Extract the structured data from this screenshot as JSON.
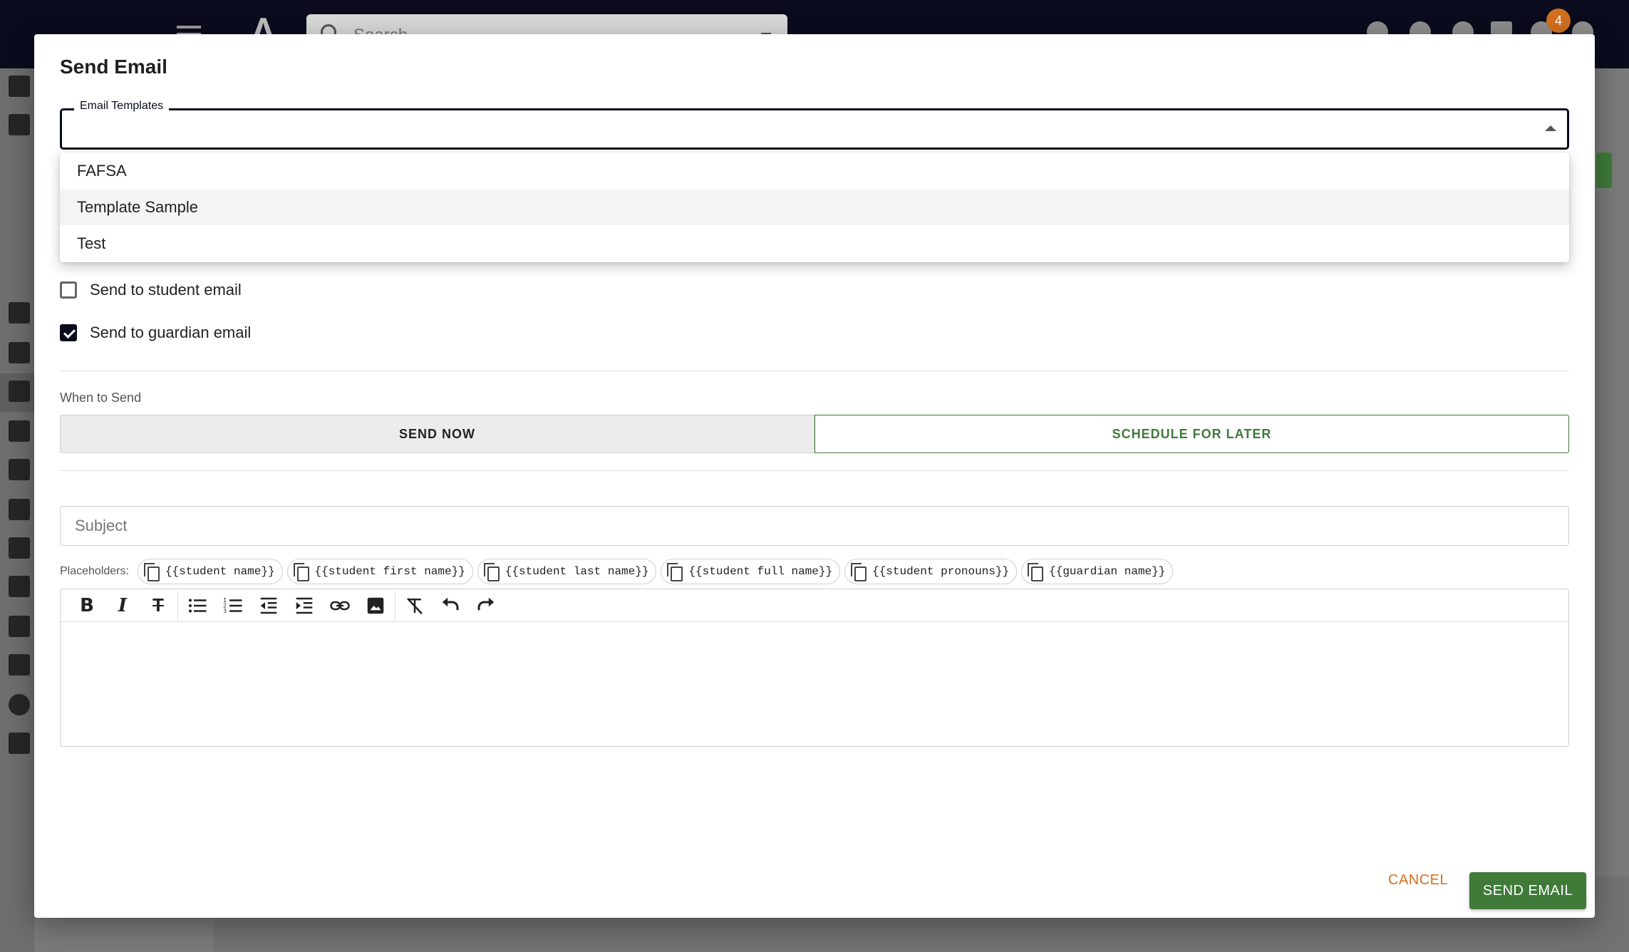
{
  "background": {
    "search_placeholder": "Search",
    "notification_count": "4"
  },
  "dialog": {
    "title": "Send Email",
    "templates_label": "Email Templates",
    "templates_value": "",
    "template_options": [
      "FAFSA",
      "Template Sample",
      "Test"
    ],
    "highlighted_option": "Template Sample",
    "send_to_student_label": "Send to student email",
    "send_to_student_checked": false,
    "send_to_guardian_label": "Send to guardian email",
    "send_to_guardian_checked": true,
    "when_label": "When to Send",
    "send_now_label": "SEND NOW",
    "schedule_label": "SCHEDULE FOR LATER",
    "subject_placeholder": "Subject",
    "subject_value": "",
    "placeholders_label": "Placeholders:",
    "placeholders": [
      "{{student name}}",
      "{{student first name}}",
      "{{student last name}}",
      "{{student full name}}",
      "{{student pronouns}}",
      "{{guardian name}}"
    ],
    "cancel_label": "CANCEL",
    "send_label": "SEND EMAIL"
  },
  "colors": {
    "primary_dark": "#0a0c1e",
    "accent_green": "#3f7a39",
    "accent_orange": "#d3701f"
  },
  "toolbar_icons": [
    "bold-icon",
    "italic-icon",
    "strikethrough-icon",
    "bullet-list-icon",
    "numbered-list-icon",
    "outdent-icon",
    "indent-icon",
    "link-icon",
    "image-icon",
    "clear-format-icon",
    "undo-icon",
    "redo-icon"
  ]
}
